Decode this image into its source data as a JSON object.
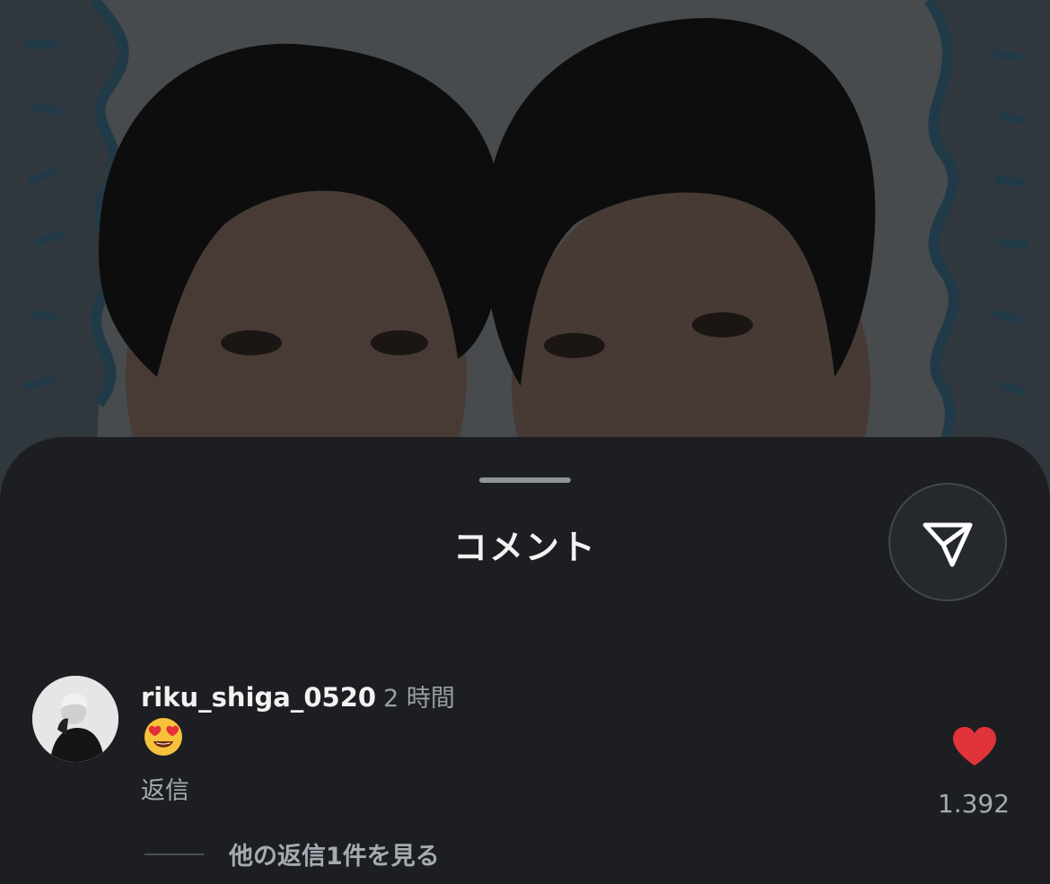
{
  "sheet": {
    "title": "コメント"
  },
  "comment": {
    "username": "riku_shiga_0520",
    "time": "2 時間",
    "emoji": "😍",
    "reply_label": "返信",
    "like_count": "1.392",
    "more_replies_label": "他の返信1件を見る"
  },
  "icons": {
    "share": "paper-plane-icon",
    "like": "heart-icon",
    "emoji": "smiling-face-with-heart-eyes"
  },
  "colors": {
    "sheet_background": "#1c1e22",
    "like": "#e0343a",
    "secondary_text": "#a6aab1"
  }
}
